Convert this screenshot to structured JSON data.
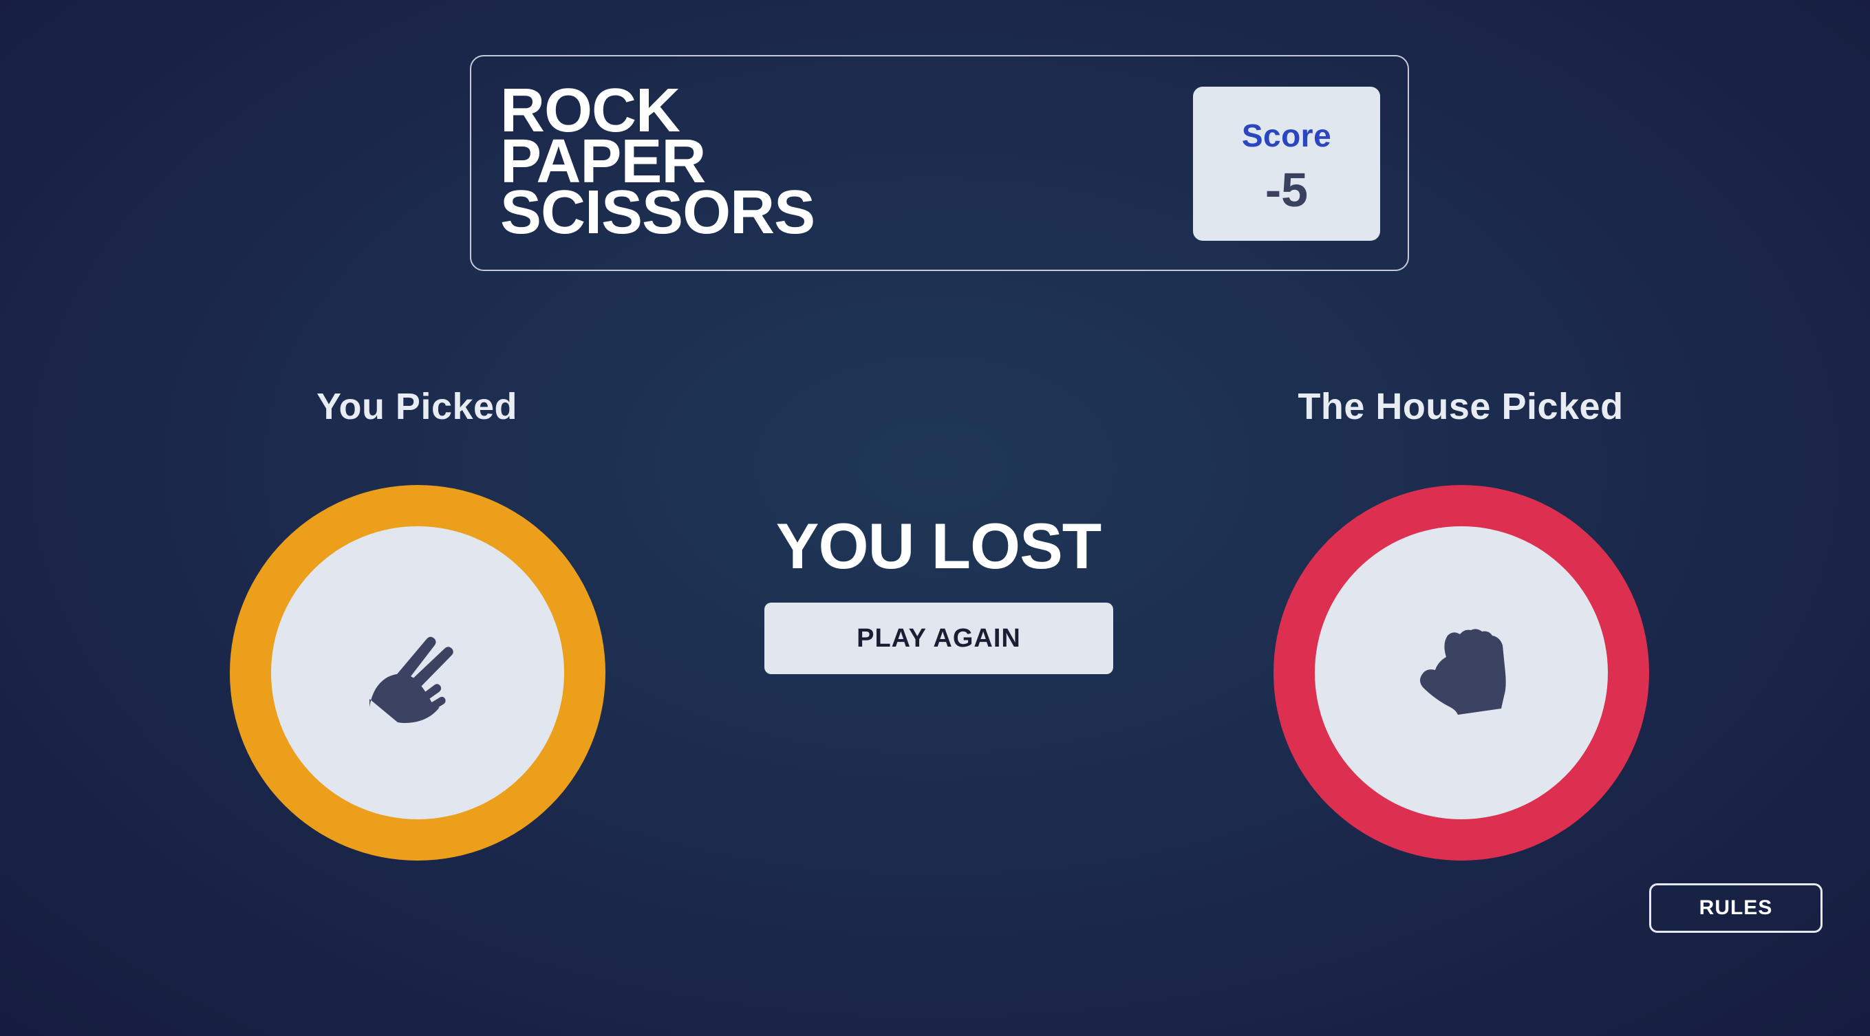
{
  "header": {
    "title_lines": [
      "ROCK",
      "PAPER",
      "SCISSORS"
    ],
    "score_label": "Score",
    "score_value": "-5"
  },
  "player": {
    "label": "You Picked",
    "choice": "scissors",
    "icon": "scissors-hand-icon",
    "ring_color": "#eb9f1b"
  },
  "house": {
    "label": "The House Picked",
    "choice": "rock",
    "icon": "rock-fist-icon",
    "ring_color": "#dd2f4f"
  },
  "result": {
    "text": "YOU LOST",
    "play_again_label": "PLAY AGAIN"
  },
  "footer": {
    "rules_label": "RULES"
  }
}
